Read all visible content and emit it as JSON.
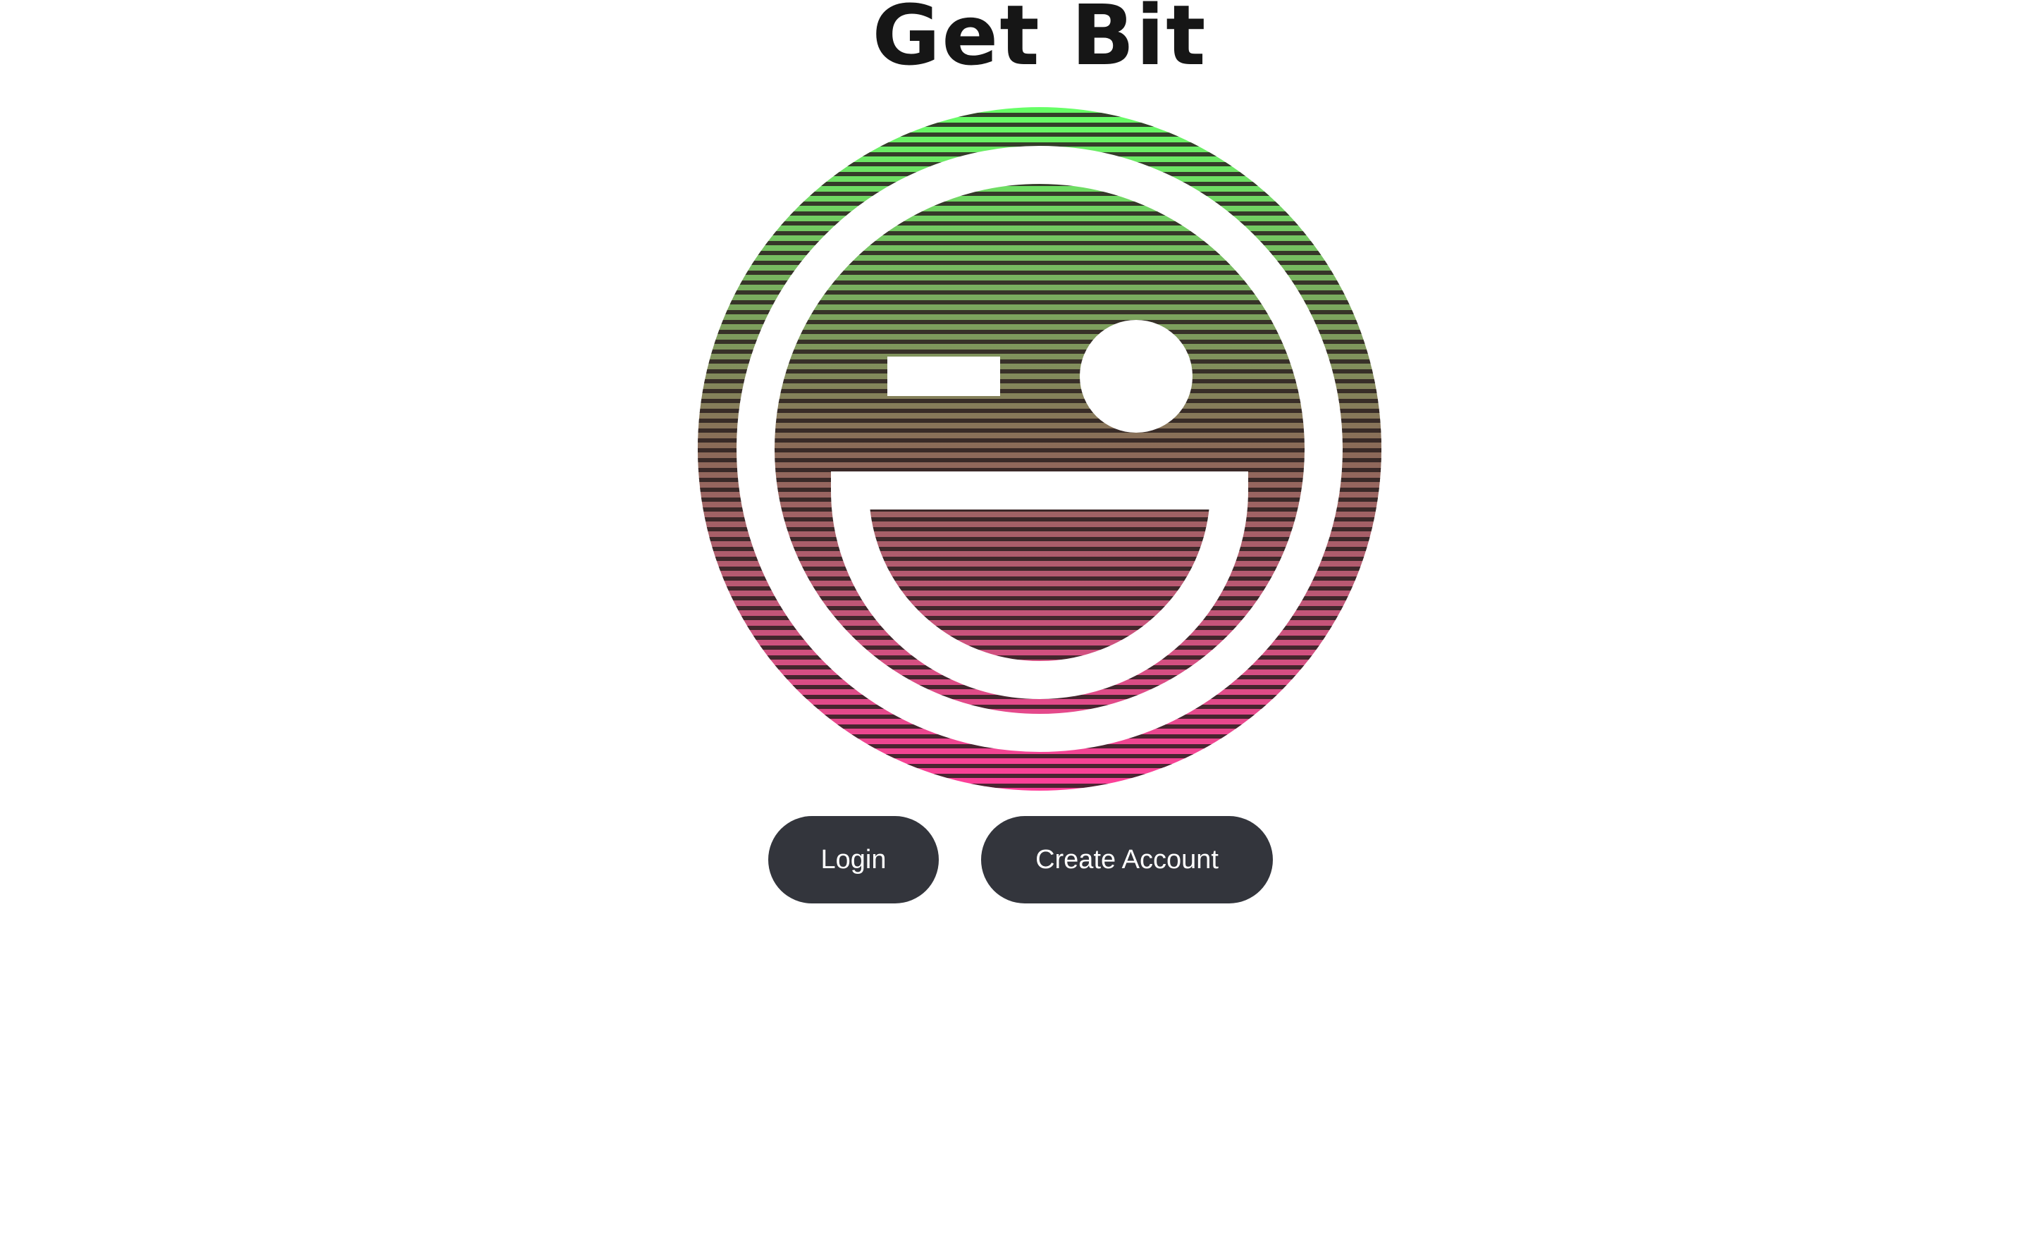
{
  "header": {
    "title": "Get Bit"
  },
  "logo": {
    "icon": "winking-smiley-logo",
    "colors": {
      "top": "#66ff66",
      "middle": "#8a6a58",
      "bottom": "#ff3f9a",
      "stripe": "#2a1f1f",
      "face_lines": "#ffffff"
    }
  },
  "actions": {
    "login_label": "Login",
    "create_account_label": "Create Account"
  },
  "theme": {
    "button_bg": "#33353c",
    "button_text": "#ffffff",
    "page_bg": "#ffffff"
  }
}
